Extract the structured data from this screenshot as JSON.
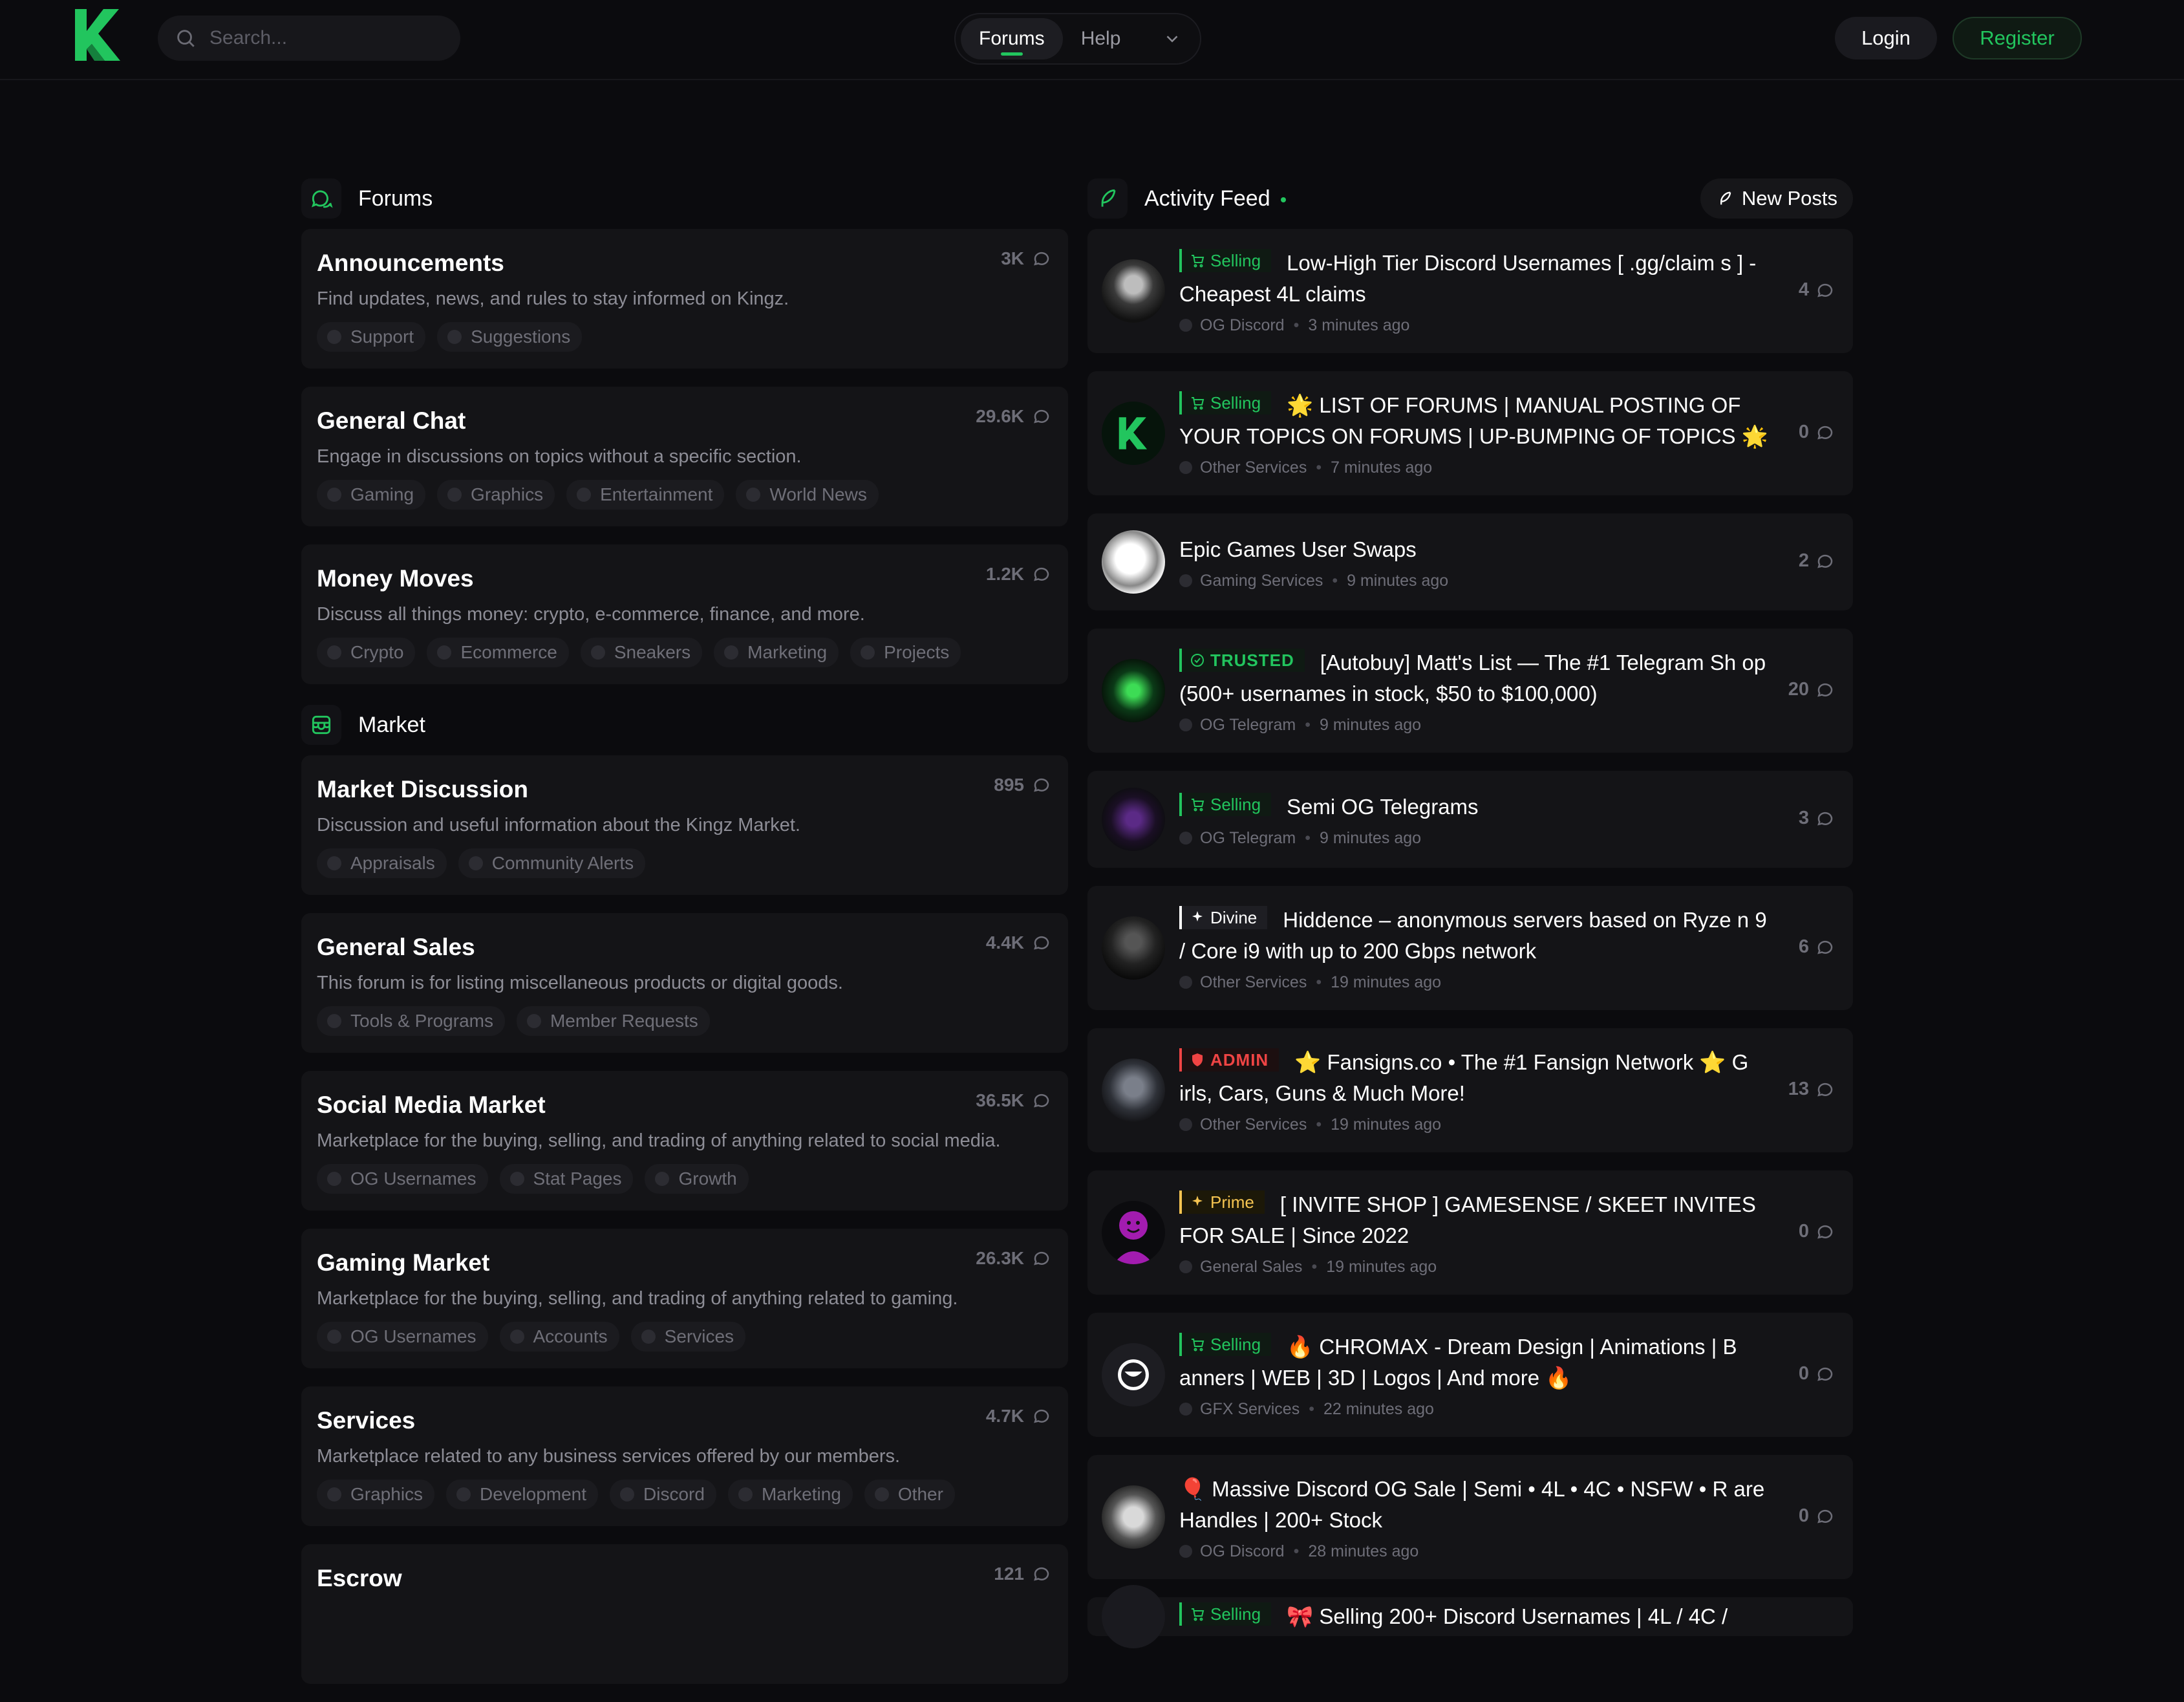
{
  "header": {
    "search_placeholder": "Search...",
    "nav": [
      {
        "label": "Forums",
        "active": true
      },
      {
        "label": "Help",
        "active": false
      }
    ],
    "login_label": "Login",
    "register_label": "Register"
  },
  "colors": {
    "accent": "#22c55e",
    "background": "#0b0b0e",
    "card": "#141417",
    "admin": "#ef4444",
    "prime": "#f5c451"
  },
  "forums_section": {
    "title": "Forums",
    "items": [
      {
        "name": "Announcements",
        "count": "3K",
        "desc": "Find updates, news, and rules to stay informed on Kingz.",
        "subs": [
          "Support",
          "Suggestions"
        ]
      },
      {
        "name": "General Chat",
        "count": "29.6K",
        "desc": "Engage in discussions on topics without a specific section.",
        "subs": [
          "Gaming",
          "Graphics",
          "Entertainment",
          "World News"
        ]
      },
      {
        "name": "Money Moves",
        "count": "1.2K",
        "desc": "Discuss all things money: crypto, e-commerce, finance, and more.",
        "subs": [
          "Crypto",
          "Ecommerce",
          "Sneakers",
          "Marketing",
          "Projects"
        ]
      }
    ]
  },
  "market_section": {
    "title": "Market",
    "items": [
      {
        "name": "Market Discussion",
        "count": "895",
        "desc": "Discussion and useful information about the Kingz Market.",
        "subs": [
          "Appraisals",
          "Community Alerts"
        ]
      },
      {
        "name": "General Sales",
        "count": "4.4K",
        "desc": "This forum is for listing miscellaneous products or digital goods.",
        "subs": [
          "Tools & Programs",
          "Member Requests"
        ]
      },
      {
        "name": "Social Media Market",
        "count": "36.5K",
        "desc": "Marketplace for the buying, selling, and trading of anything related to social media.",
        "subs": [
          "OG Usernames",
          "Stat Pages",
          "Growth"
        ]
      },
      {
        "name": "Gaming Market",
        "count": "26.3K",
        "desc": "Marketplace for the buying, selling, and trading of anything related to gaming.",
        "subs": [
          "OG Usernames",
          "Accounts",
          "Services"
        ]
      },
      {
        "name": "Services",
        "count": "4.7K",
        "desc": "Marketplace related to any business services offered by our members.",
        "subs": [
          "Graphics",
          "Development",
          "Discord",
          "Marketing",
          "Other"
        ]
      },
      {
        "name": "Escrow",
        "count": "121",
        "desc": "",
        "subs": []
      }
    ]
  },
  "activity": {
    "title": "Activity Feed",
    "new_posts_label": "New Posts",
    "posts": [
      {
        "badge": "Selling",
        "badge_type": "selling",
        "title": "Low-High Tier Discord Usernames [ .gg/claim s ] - Cheapest 4L claims",
        "forum": "OG Discord",
        "time": "3 minutes ago",
        "replies": "4"
      },
      {
        "badge": "Selling",
        "badge_type": "selling",
        "title": "🌟 LIST OF FORUMS | MANUAL POSTING OF YOUR TOPICS ON FORUMS | UP-BUMPING OF TOPICS 🌟",
        "forum": "Other Services",
        "time": "7 minutes ago",
        "replies": "0"
      },
      {
        "badge": "",
        "badge_type": "",
        "title": "Epic Games User Swaps",
        "forum": "Gaming Services",
        "time": "9 minutes ago",
        "replies": "2"
      },
      {
        "badge": "TRUSTED",
        "badge_type": "trusted",
        "title": "[Autobuy] Matt's List — The #1 Telegram Sh op (500+ usernames in stock, $50 to $100,000)",
        "forum": "OG Telegram",
        "time": "9 minutes ago",
        "replies": "20"
      },
      {
        "badge": "Selling",
        "badge_type": "selling",
        "title": "Semi OG Telegrams",
        "forum": "OG Telegram",
        "time": "9 minutes ago",
        "replies": "3"
      },
      {
        "badge": "Divine",
        "badge_type": "divine",
        "title": "Hiddence – anonymous servers based on Ryze n 9 / Core i9 with up to 200 Gbps network",
        "forum": "Other Services",
        "time": "19 minutes ago",
        "replies": "6"
      },
      {
        "badge": "ADMIN",
        "badge_type": "admin",
        "title": "⭐ Fansigns.co • The #1 Fansign Network ⭐ G irls, Cars, Guns & Much More!",
        "forum": "Other Services",
        "time": "19 minutes ago",
        "replies": "13"
      },
      {
        "badge": "Prime",
        "badge_type": "prime",
        "title": "[ INVITE SHOP ] GAMESENSE / SKEET INVITES FOR SALE | Since 2022",
        "forum": "General Sales",
        "time": "19 minutes ago",
        "replies": "0"
      },
      {
        "badge": "Selling",
        "badge_type": "selling",
        "title": "🔥 CHROMAX - Dream Design | Animations | B anners | WEB | 3D | Logos | And more 🔥",
        "forum": "GFX Services",
        "time": "22 minutes ago",
        "replies": "0"
      },
      {
        "badge": "",
        "badge_type": "",
        "title": "🎈 Massive Discord OG Sale | Semi • 4L • 4C • NSFW • R are Handles | 200+ Stock",
        "forum": "OG Discord",
        "time": "28 minutes ago",
        "replies": "0"
      },
      {
        "badge": "Selling",
        "badge_type": "selling",
        "title": "🎀 Selling 200+ Discord Usernames | 4L / 4C /",
        "forum": "",
        "time": "",
        "replies": ""
      }
    ]
  }
}
